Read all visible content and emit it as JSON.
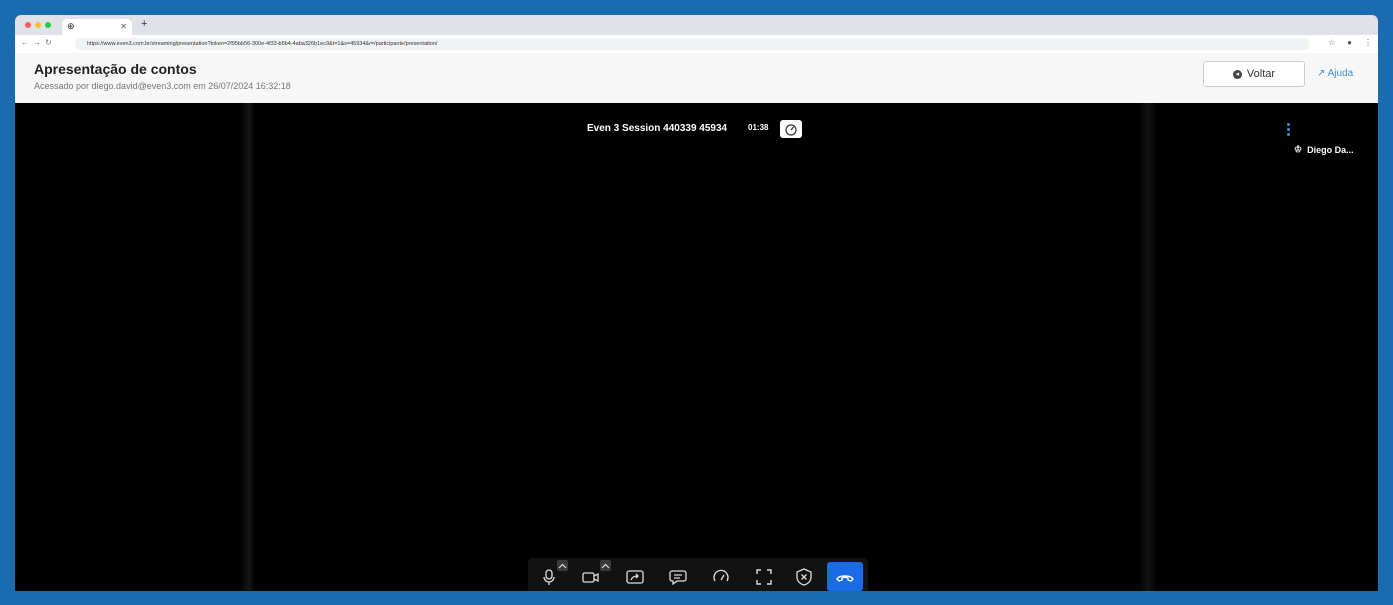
{
  "browser": {
    "tab_title": "",
    "tab_favicon": "globe-icon",
    "url": "https://www.even3.com.br/streaming/presentation?token=2f95bb56-300e-4f33-b5b4-4aba326b1ec9&t=1&s=45934&r=/participante/presentation/"
  },
  "header": {
    "title": "Apresentação de contos",
    "subtitle": "Acessado por diego.david@even3.com em 26/07/2024 16:32:18",
    "back_button": "Voltar",
    "help_link": "Ajuda"
  },
  "meeting": {
    "session_title": "Even 3 Session 440339 45934",
    "timer": "01:38",
    "participant_name": "Diego Da..."
  },
  "toolbar": {
    "items": [
      "microphone-icon",
      "camera-icon",
      "share-screen-icon",
      "chat-icon",
      "speed-icon",
      "fullscreen-icon",
      "security-icon",
      "hangup-icon"
    ]
  },
  "colors": {
    "background": "#1b6bb0",
    "accent": "#1a6ce6",
    "link": "#3b8fd6"
  }
}
